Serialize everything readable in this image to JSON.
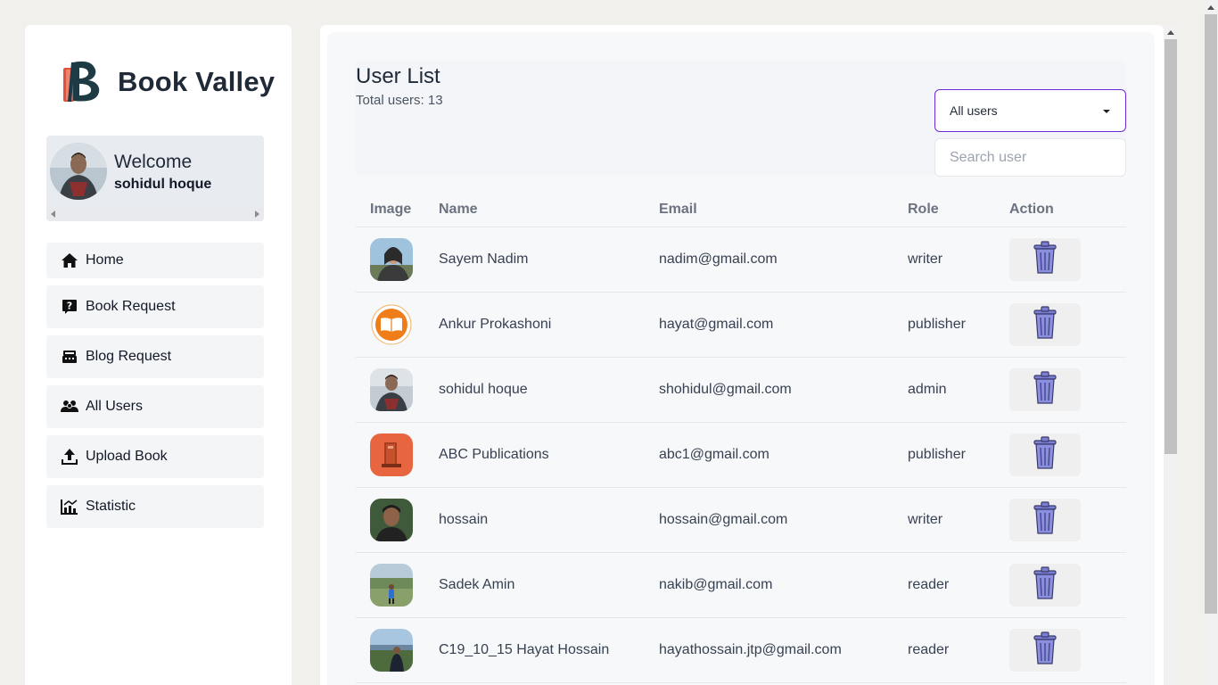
{
  "brand": {
    "name": "Book Valley"
  },
  "welcome": {
    "title": "Welcome",
    "user": "sohidul hoque"
  },
  "nav": [
    {
      "label": "Home",
      "icon": "home-icon"
    },
    {
      "label": "Book Request",
      "icon": "question-book-icon"
    },
    {
      "label": "Blog Request",
      "icon": "blog-icon"
    },
    {
      "label": "All Users",
      "icon": "users-icon"
    },
    {
      "label": "Upload Book",
      "icon": "upload-icon"
    },
    {
      "label": "Statistic",
      "icon": "chart-icon"
    }
  ],
  "page": {
    "title": "User List",
    "total_label": "Total users: 13"
  },
  "filter": {
    "selected": "All users"
  },
  "search": {
    "placeholder": "Search user"
  },
  "table": {
    "headers": {
      "image": "Image",
      "name": "Name",
      "email": "Email",
      "role": "Role",
      "action": "Action"
    },
    "rows": [
      {
        "name": "Sayem Nadim",
        "email": "nadim@gmail.com",
        "role": "writer"
      },
      {
        "name": "Ankur Prokashoni",
        "email": "hayat@gmail.com",
        "role": "publisher"
      },
      {
        "name": "sohidul hoque",
        "email": "shohidul@gmail.com",
        "role": "admin"
      },
      {
        "name": "ABC Publications",
        "email": "abc1@gmail.com",
        "role": "publisher"
      },
      {
        "name": "hossain",
        "email": "hossain@gmail.com",
        "role": "writer"
      },
      {
        "name": "Sadek Amin",
        "email": "nakib@gmail.com",
        "role": "reader"
      },
      {
        "name": "C19_10_15 Hayat Hossain",
        "email": "hayathossain.jtp@gmail.com",
        "role": "reader"
      }
    ]
  },
  "colors": {
    "accent": "#6d28d9",
    "trash": "#7b7fd1"
  }
}
